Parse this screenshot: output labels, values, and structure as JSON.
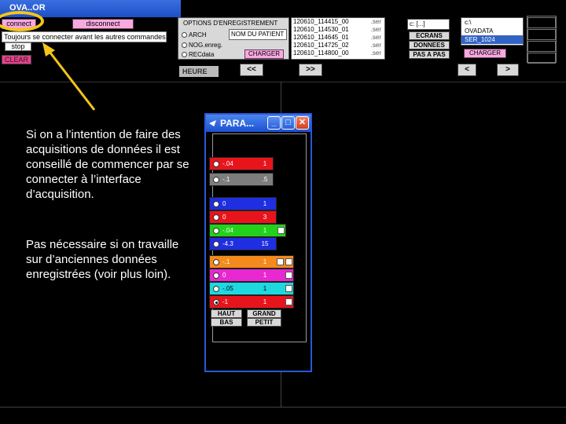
{
  "app": {
    "title": "OVA..OR",
    "connect_label": "connect",
    "disconnect_label": "disconnect",
    "connect_note": "Toujours se connecter avant les autres commandes",
    "stop_label": "stop",
    "clear_label": "CLEAR"
  },
  "recording": {
    "title": "OPTIONS D'ENREGISTREMENT",
    "options": [
      "ARCH",
      "NOG.enreg.",
      "RECdata"
    ],
    "patient_placeholder": "NOM DU PATIENT",
    "load_label": "CHARGER"
  },
  "files": [
    {
      "name": "120610_114415_00",
      "ext": ".ser"
    },
    {
      "name": "120610_114530_01",
      "ext": ".ser"
    },
    {
      "name": "120610_114645_01",
      "ext": ".ser"
    },
    {
      "name": "120610_114725_02",
      "ext": ".ser"
    },
    {
      "name": "120610_114800_00",
      "ext": ".ser"
    }
  ],
  "navigation": {
    "drive": "c: [...]",
    "screens_label": "ECRANS",
    "data_label": "DONNEES",
    "step_label": "PAS A PAS",
    "tree": [
      "c:\\",
      "OVADATA",
      "SER_1024"
    ],
    "load_label": "CHARGER",
    "hour_label": "HEURE",
    "prev_label": "<<",
    "next_label": ">>",
    "left_label": "<",
    "right_label": ">"
  },
  "explanation": {
    "paragraph1": "Si on a l’intention de faire des acquisitions de données il est conseillé de commencer par se connecter à l’interface d’acquisition.",
    "paragraph2": "Pas nécessaire si on travaille sur d’anciennes données enregistrées (voir plus loin)."
  },
  "para_window": {
    "title": "PARA...",
    "channels": [
      {
        "min": "-.04",
        "max": "1",
        "color": "#e8141c",
        "dark": false
      },
      {
        "min": "-.1",
        "max": ".5",
        "color": "#7d7d7d",
        "dark": false
      },
      {
        "min": "0",
        "max": "1",
        "color": "#1f2ee0",
        "dark": false
      },
      {
        "min": "0",
        "max": "3",
        "color": "#e8141c",
        "dark": false
      },
      {
        "min": "-.04",
        "max": "1",
        "color": "#22d21a",
        "dark": false
      },
      {
        "min": "-4.3",
        "max": "15",
        "color": "#1f2ee0",
        "dark": false
      },
      {
        "min": "-.1",
        "max": "1",
        "color": "#f58a1c",
        "dark": false
      },
      {
        "min": "0",
        "max": "1",
        "color": "#e828d0",
        "dark": false
      },
      {
        "min": "-.05",
        "max": "1",
        "color": "#1ed8e0",
        "dark": true
      },
      {
        "min": "-1",
        "max": "1",
        "color": "#e8141c",
        "dark": false
      }
    ],
    "haut_label": "HAUT",
    "bas_label": "BAS",
    "grand_label": "GRAND",
    "petit_label": "PETIT"
  },
  "colors": {
    "highlight": "#f5c518",
    "title_bar": "#1c50d0"
  }
}
